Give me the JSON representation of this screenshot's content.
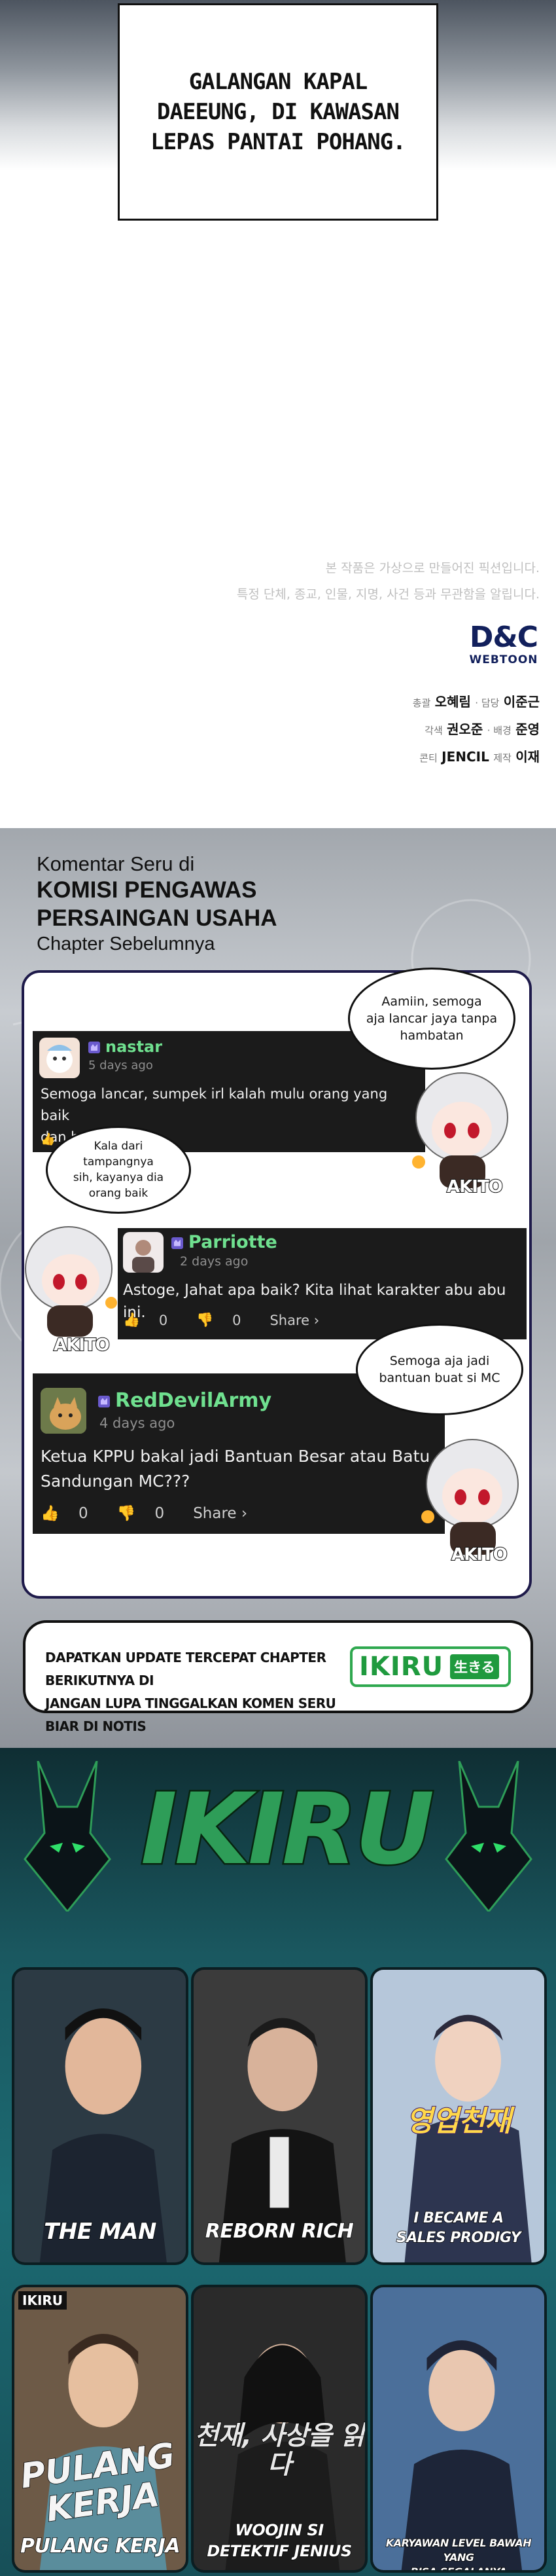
{
  "caption": {
    "lines": [
      "GALANGAN KAPAL",
      "DAEEUNG, DI KAWASAN",
      "LEPAS PANTAI POHANG."
    ]
  },
  "notice": {
    "line1": "본 작품은 가상으로 만들어진 픽션입니다.",
    "line2": "특정 단체, 종교, 인물, 지명, 사건 등과 무관함을 알립니다."
  },
  "publisher": {
    "logo_main": "D&C",
    "logo_sub": "WEBTOON"
  },
  "credits": {
    "row1_label1": "총괄",
    "row1_name1": "오혜림",
    "row1_label2": "· 담당",
    "row1_name2": "이준근",
    "row2_label1": "각색",
    "row2_name1": "권오준",
    "row2_label2": "· 배경",
    "row2_name2": "준영",
    "row3_label1": "콘티",
    "row3_name1": "JENCIL",
    "row3_label2": "제작",
    "row3_name2": "이재"
  },
  "comments_section": {
    "heading": "Komentar Seru di",
    "title_line1": "KOMISI PENGAWAS",
    "title_line2": "PERSAINGAN USAHA",
    "subtitle": "Chapter Sebelumnya"
  },
  "comments": [
    {
      "user": "nastar",
      "time": "5 days ago",
      "text_line1": "Semoga lancar, sumpek irl kalah mulu orang yang baik",
      "text_line2": "dan benar"
    },
    {
      "user": "Parriotte",
      "time": "2 days ago",
      "text_line1": "Astoge, Jahat apa baik? Kita lihat karakter abu abu ini.",
      "likes": "0",
      "dislikes": "0",
      "share": "Share ›"
    },
    {
      "user": "RedDevilArmy",
      "time": "4 days ago",
      "text_line1": "Ketua KPPU bakal jadi Bantuan Besar atau Batu",
      "text_line2": "Sandungan MC???",
      "likes": "0",
      "dislikes": "0",
      "share": "Share ›"
    }
  ],
  "bubbles": {
    "b1_line1": "Aamiin, semoga",
    "b1_line2": "aja lancar jaya tanpa",
    "b1_line3": "hambatan",
    "b2_line1": "Kala dari tampangnya",
    "b2_line2": "sih, kayanya dia",
    "b2_line3": "orang baik",
    "b3_line1": "Semoga aja jadi",
    "b3_line2": "bantuan buat si MC"
  },
  "mascot_name": "AKITO",
  "promo": {
    "line1": "DAPATKAN UPDATE TERCEPAT CHAPTER BERIKUTNYA DI",
    "line2": "JANGAN LUPA TINGGALKAN KOMEN SERU BIAR DI NOTIS",
    "logo": "IKIRU",
    "logo_kanji": "生きる"
  },
  "ikiru_title": "IKIRU",
  "series": [
    {
      "label": "THE MAN"
    },
    {
      "label": "REBORN RICH"
    },
    {
      "label_line1": "I BECAME A",
      "label_line2": "SALES PRODIGY",
      "art_text": "영업천재"
    },
    {
      "label": "PULANG KERJA",
      "art_text": "PULANG KERJA",
      "badge": "IKIRU"
    },
    {
      "label_line1": "WOOJIN SI",
      "label_line2": "DETEKTIF JENIUS",
      "art_text": "천재, 사상을 읽다"
    },
    {
      "label_line1": "KARYAWAN LEVEL BAWAH YANG",
      "label_line2": "BISA SEGALANYA"
    }
  ],
  "colors": {
    "panel_border": "#1e1a4a",
    "username_green": "#6fe08f",
    "ikiru_green": "#2e9d58",
    "teal_background": "#1a5860"
  }
}
